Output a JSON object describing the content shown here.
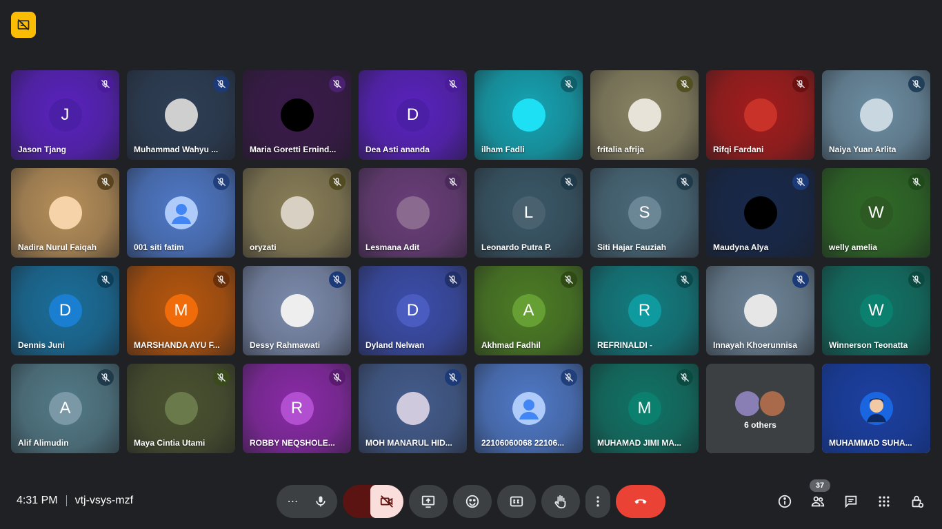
{
  "participants": [
    {
      "name": "Jason Tjang",
      "initial": "J",
      "bg": "#5a22c0",
      "avatar_bg": "#4b1fa6",
      "mic_bg": "#4a1c9c",
      "avatar_type": "initial"
    },
    {
      "name": "Muhammad Wahyu ...",
      "initial": "",
      "bg": "#2d3e55",
      "avatar_bg": "#cfcfcf",
      "mic_bg": "#1d3a78",
      "avatar_type": "photo"
    },
    {
      "name": "Maria Goretti Ernind...",
      "initial": "",
      "bg": "#3a1a4a",
      "avatar_bg": "#000000",
      "mic_bg": "#4a2070",
      "avatar_type": "photo"
    },
    {
      "name": "Dea Asti ananda",
      "initial": "D",
      "bg": "#5a22c0",
      "avatar_bg": "#4b1fa6",
      "mic_bg": "#4a1c9c",
      "avatar_type": "initial"
    },
    {
      "name": "ilham Fadli",
      "initial": "",
      "bg": "#15a5b4",
      "avatar_bg": "#1ee0f5",
      "mic_bg": "#0e5f6a",
      "avatar_type": "photo"
    },
    {
      "name": "fritalia afrija",
      "initial": "",
      "bg": "#8a8463",
      "avatar_bg": "#e8e3d8",
      "mic_bg": "#525020",
      "avatar_type": "photo"
    },
    {
      "name": "Rifqi Fardani",
      "initial": "",
      "bg": "#a41c1c",
      "avatar_bg": "#c83228",
      "mic_bg": "#6a1010",
      "avatar_type": "photo"
    },
    {
      "name": "Naiya Yuan Arlita",
      "initial": "",
      "bg": "#6d8ea3",
      "avatar_bg": "#c9d7e0",
      "mic_bg": "#213f5a",
      "avatar_type": "photo"
    },
    {
      "name": "Nadira Nurul Faiqah",
      "initial": "",
      "bg": "#b8905a",
      "avatar_bg": "#f6d3a8",
      "mic_bg": "#5a4420",
      "avatar_type": "photo"
    },
    {
      "name": "001 siti fatim",
      "initial": "",
      "bg": "#4f79c8",
      "avatar_bg": "#aecbfa",
      "mic_bg": "#213f7a",
      "avatar_type": "default"
    },
    {
      "name": "oryzati",
      "initial": "",
      "bg": "#8a7f58",
      "avatar_bg": "#d8d0c2",
      "mic_bg": "#524a20",
      "avatar_type": "photo"
    },
    {
      "name": "Lesmana Adit",
      "initial": "",
      "bg": "#6a3e7a",
      "avatar_bg": "#8a6a8e",
      "mic_bg": "#4a2a5a",
      "avatar_type": "photo"
    },
    {
      "name": "Leonardo Putra P.",
      "initial": "L",
      "bg": "#3a5868",
      "avatar_bg": "#4a6170",
      "mic_bg": "#1f3a4a",
      "avatar_type": "initial"
    },
    {
      "name": "Siti Hajar Fauziah",
      "initial": "S",
      "bg": "#4a6a7a",
      "avatar_bg": "#6b8796",
      "mic_bg": "#1f3a4a",
      "avatar_type": "initial"
    },
    {
      "name": "Maudyna Alya",
      "initial": "",
      "bg": "#17284a",
      "avatar_bg": "#000000",
      "mic_bg": "#1d3a78",
      "avatar_type": "photo"
    },
    {
      "name": "welly amelia",
      "initial": "W",
      "bg": "#2f6a26",
      "avatar_bg": "#2d5a22",
      "mic_bg": "#1f4a1a",
      "avatar_type": "initial"
    },
    {
      "name": "Dennis Juni",
      "initial": "D",
      "bg": "#1a6f9c",
      "avatar_bg": "#1a7fd0",
      "mic_bg": "#0e3f5a",
      "avatar_type": "initial"
    },
    {
      "name": "MARSHANDA AYU F...",
      "initial": "M",
      "bg": "#b7560d",
      "avatar_bg": "#f06c0b",
      "mic_bg": "#6a300a",
      "avatar_type": "initial"
    },
    {
      "name": "Dessy Rahmawati",
      "initial": "",
      "bg": "#7d8cae",
      "avatar_bg": "#eeeeee",
      "mic_bg": "#1d3a78",
      "avatar_type": "photo"
    },
    {
      "name": "Dyland Nelwan",
      "initial": "D",
      "bg": "#3b4dab",
      "avatar_bg": "#4a5cc0",
      "mic_bg": "#22306a",
      "avatar_type": "initial"
    },
    {
      "name": "Akhmad Fadhil",
      "initial": "A",
      "bg": "#4c7d24",
      "avatar_bg": "#66a034",
      "mic_bg": "#2f4a14",
      "avatar_type": "initial"
    },
    {
      "name": "REFRINALDI -",
      "initial": "R",
      "bg": "#127d80",
      "avatar_bg": "#0f9aa0",
      "mic_bg": "#0a4a4c",
      "avatar_type": "initial"
    },
    {
      "name": "Innayah Khoerunnisa",
      "initial": "",
      "bg": "#6d8497",
      "avatar_bg": "#e6e6e6",
      "mic_bg": "#1d3a78",
      "avatar_type": "photo"
    },
    {
      "name": "Winnerson Teonatta",
      "initial": "W",
      "bg": "#117366",
      "avatar_bg": "#0b806f",
      "mic_bg": "#0a4a40",
      "avatar_type": "initial"
    },
    {
      "name": "Alif Alimudin",
      "initial": "A",
      "bg": "#537b88",
      "avatar_bg": "#7a98a6",
      "mic_bg": "#1f3a4a",
      "avatar_type": "initial"
    },
    {
      "name": "Maya Cintia Utami",
      "initial": "",
      "bg": "#4a5230",
      "avatar_bg": "#6a7a4a",
      "mic_bg": "#3a4a1a",
      "avatar_type": "photo"
    },
    {
      "name": "ROBBY NEQSHOLE...",
      "initial": "R",
      "bg": "#8a2aa8",
      "avatar_bg": "#b24fd0",
      "mic_bg": "#5a1a70",
      "avatar_type": "initial"
    },
    {
      "name": "MOH MANARUL HID...",
      "initial": "",
      "bg": "#445d8e",
      "avatar_bg": "#cfc9de",
      "mic_bg": "#1d3a78",
      "avatar_type": "photo"
    },
    {
      "name": "22106060068 22106...",
      "initial": "",
      "bg": "#4f79c8",
      "avatar_bg": "#aecbfa",
      "mic_bg": "#213f7a",
      "avatar_type": "default"
    },
    {
      "name": "MUHAMAD JIMI MA...",
      "initial": "M",
      "bg": "#117366",
      "avatar_bg": "#0b806f",
      "mic_bg": "#0a4a40",
      "avatar_type": "initial"
    }
  ],
  "others": {
    "label": "6 others"
  },
  "self_tile": {
    "name": "MUHAMMAD SUHA...",
    "bg": "#1d3fa0"
  },
  "meeting": {
    "time": "4:31 PM",
    "code": "vtj-vsys-mzf"
  },
  "people_count": "37",
  "colors": {
    "camera_off_accent": "#f9dedc",
    "leave_red": "#ea4335",
    "brand_badge": "#fbbc04"
  },
  "icons": {
    "more_options": "more-horizontal-icon",
    "mic": "mic-icon",
    "camera": "camera-off-icon",
    "present": "present-screen-icon",
    "reactions": "emoji-icon",
    "captions": "captions-icon",
    "hand": "raise-hand-icon",
    "more_vertical": "more-vertical-icon",
    "leave": "leave-call-icon",
    "info": "info-icon",
    "people": "people-icon",
    "chat": "chat-icon",
    "activities": "activities-grid-icon",
    "host": "host-controls-icon"
  }
}
